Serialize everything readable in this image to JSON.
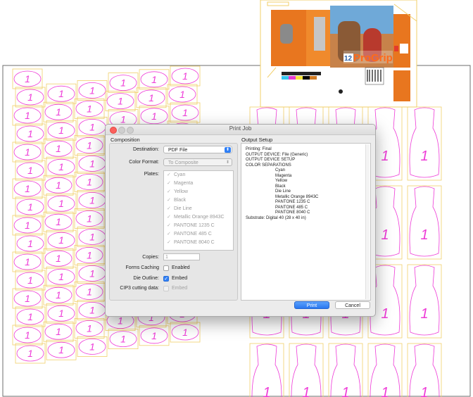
{
  "background_label": "1",
  "colors": {
    "magenta": "#ee3bd7",
    "yellow": "#f1cf6a",
    "accent": "#2f7ff6"
  },
  "package": {
    "brand": "ProGrip",
    "badge": "12"
  },
  "dialog": {
    "title": "Print Job",
    "composition": {
      "section_label": "Composition",
      "destination_label": "Destination:",
      "destination_value": "PDF File",
      "color_format_label": "Color Format:",
      "color_format_value": "To Composite",
      "plates_label": "Plates:",
      "plates": [
        "Cyan",
        "Magenta",
        "Yellow",
        "Black",
        "Die Line",
        "Metallic Orange 8943C",
        "PANTONE 1235 C",
        "PANTONE 485 C",
        "PANTONE 8040 C"
      ],
      "copies_label": "Copies:",
      "copies_value": "1",
      "forms_caching_label": "Forms Caching",
      "forms_caching_option": "Enabled",
      "die_outline_label": "Die Outline:",
      "die_outline_option": "Embed",
      "cip3_label": "CIP3 cutting data:",
      "cip3_option": "Embed"
    },
    "output_setup": {
      "section_label": "Output Setup",
      "lines": [
        "Printing: Final",
        "OUTPUT DEVICE: File (Generic)",
        "OUTPUT DEVICE SETUP",
        "COLOR SEPARATIONS",
        "Cyan",
        "Magenta",
        "Yellow",
        "Black",
        "Die Line",
        "Metallic Orange 8943C",
        "PANTONE 1235 C",
        "PANTONE 485 C",
        "PANTONE 8040 C",
        "Substrate: Digital 40 (28 x 40 in)"
      ]
    },
    "buttons": {
      "print": "Print",
      "cancel": "Cancel"
    }
  }
}
